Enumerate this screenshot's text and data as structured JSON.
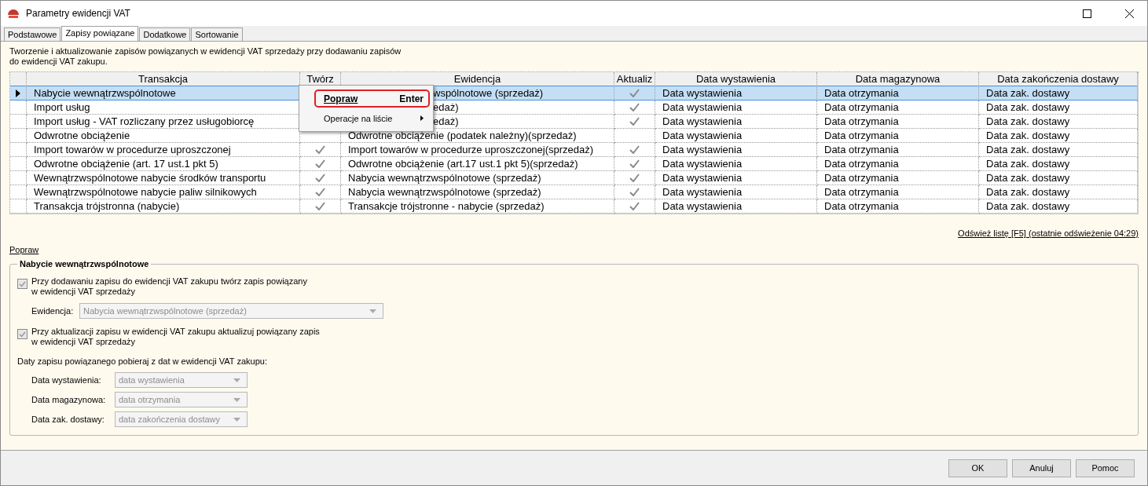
{
  "window": {
    "title": "Parametry ewidencji VAT"
  },
  "tabs": [
    {
      "label": "Podstawowe",
      "selected": false
    },
    {
      "label": "Zapisy powiązane",
      "selected": true
    },
    {
      "label": "Dodatkowe",
      "selected": false
    },
    {
      "label": "Sortowanie",
      "selected": false
    }
  ],
  "description": "Tworzenie i aktualizowanie zapisów powiązanych w ewidencji VAT sprzedaży przy dodawaniu zapisów do ewidencji VAT zakupu.",
  "table": {
    "columns": [
      "Transakcja",
      "Twórz",
      "Ewidencja",
      "Aktualiz",
      "Data wystawienia",
      "Data magazynowa",
      "Data zakończenia dostawy"
    ],
    "rows": [
      {
        "selected": true,
        "covered": true,
        "transakcja": "Nabycie wewnątrzwspólnotowe",
        "ewidencja": "wspólnotowe (sprzedaż)",
        "update": true,
        "data_wyst": "Data wystawienia",
        "data_mag": "Data otrzymania",
        "data_zak": "Data zak. dostawy"
      },
      {
        "selected": false,
        "covered": true,
        "transakcja": "Import usług",
        "ewidencja": "edaż)",
        "update": true,
        "data_wyst": "Data wystawienia",
        "data_mag": "Data otrzymania",
        "data_zak": "Data zak. dostawy"
      },
      {
        "selected": false,
        "covered": true,
        "transakcja": "Import usług - VAT rozliczany przez usługobiorcę",
        "ewidencja": "edaż)",
        "update": true,
        "data_wyst": "Data wystawienia",
        "data_mag": "Data otrzymania",
        "data_zak": "Data zak. dostawy"
      },
      {
        "selected": false,
        "covered": false,
        "transakcja": "Odwrotne obciążenie",
        "create": false,
        "ewidencja": "Odwrotne obciążenie (podatek należny)(sprzedaż)",
        "update": false,
        "data_wyst": "Data wystawienia",
        "data_mag": "Data otrzymania",
        "data_zak": "Data zak. dostawy"
      },
      {
        "selected": false,
        "covered": false,
        "transakcja": "Import towarów w procedurze uproszczonej",
        "create": true,
        "ewidencja": "Import towarów w procedurze uproszczonej(sprzedaż)",
        "update": true,
        "data_wyst": "Data wystawienia",
        "data_mag": "Data otrzymania",
        "data_zak": "Data zak. dostawy"
      },
      {
        "selected": false,
        "covered": false,
        "transakcja": "Odwrotne obciążenie (art. 17 ust.1 pkt 5)",
        "create": true,
        "ewidencja": "Odwrotne obciążenie (art.17 ust.1 pkt 5)(sprzedaż)",
        "update": true,
        "data_wyst": "Data wystawienia",
        "data_mag": "Data otrzymania",
        "data_zak": "Data zak. dostawy"
      },
      {
        "selected": false,
        "covered": false,
        "transakcja": "Wewnątrzwspólnotowe nabycie środków transportu",
        "create": true,
        "ewidencja": "Nabycia wewnątrzwspólnotowe (sprzedaż)",
        "update": true,
        "data_wyst": "Data wystawienia",
        "data_mag": "Data otrzymania",
        "data_zak": "Data zak. dostawy"
      },
      {
        "selected": false,
        "covered": false,
        "transakcja": "Wewnątrzwspólnotowe nabycie paliw silnikowych",
        "create": true,
        "ewidencja": "Nabycia wewnątrzwspólnotowe (sprzedaż)",
        "update": true,
        "data_wyst": "Data wystawienia",
        "data_mag": "Data otrzymania",
        "data_zak": "Data zak. dostawy"
      },
      {
        "selected": false,
        "covered": false,
        "transakcja": "Transakcja trójstronna (nabycie)",
        "create": true,
        "ewidencja": "Transakcje trójstronne - nabycie (sprzedaż)",
        "update": true,
        "data_wyst": "Data wystawienia",
        "data_mag": "Data otrzymania",
        "data_zak": "Data zak. dostawy"
      }
    ]
  },
  "context_menu": {
    "items": [
      {
        "label": "Popraw",
        "shortcut": "Enter",
        "selected": true,
        "submenu": false
      },
      {
        "label": "Operacje na liście",
        "selected": false,
        "submenu": true
      }
    ]
  },
  "refresh_link": "Odśwież listę [F5] (ostatnie odświeżenie 04:29)",
  "edit_link": "Popraw",
  "group": {
    "title": "Nabycie wewnątrzwspólnotowe",
    "create_checkbox": {
      "label": "Przy dodawaniu zapisu do ewidencji VAT zakupu twórz zapis powiązany\nw ewidencji VAT sprzedaży",
      "checked": true
    },
    "ewidencja": {
      "label": "Ewidencja:",
      "value": "Nabycia wewnątrzwspólnotowe (sprzedaż)"
    },
    "update_checkbox": {
      "label": "Przy aktualizacji zapisu w ewidencji VAT zakupu aktualizuj powiązany zapis\nw ewidencji VAT sprzedaży",
      "checked": true
    },
    "dates_caption": "Daty zapisu powiązanego pobieraj z dat w ewidencji VAT zakupu:",
    "dates": [
      {
        "label": "Data wystawienia:",
        "value": "data wystawienia"
      },
      {
        "label": "Data magazynowa:",
        "value": "data otrzymania"
      },
      {
        "label": "Data zak. dostawy:",
        "value": "data zakończenia dostawy"
      }
    ]
  },
  "buttons": [
    "OK",
    "Anuluj",
    "Pomoc"
  ]
}
